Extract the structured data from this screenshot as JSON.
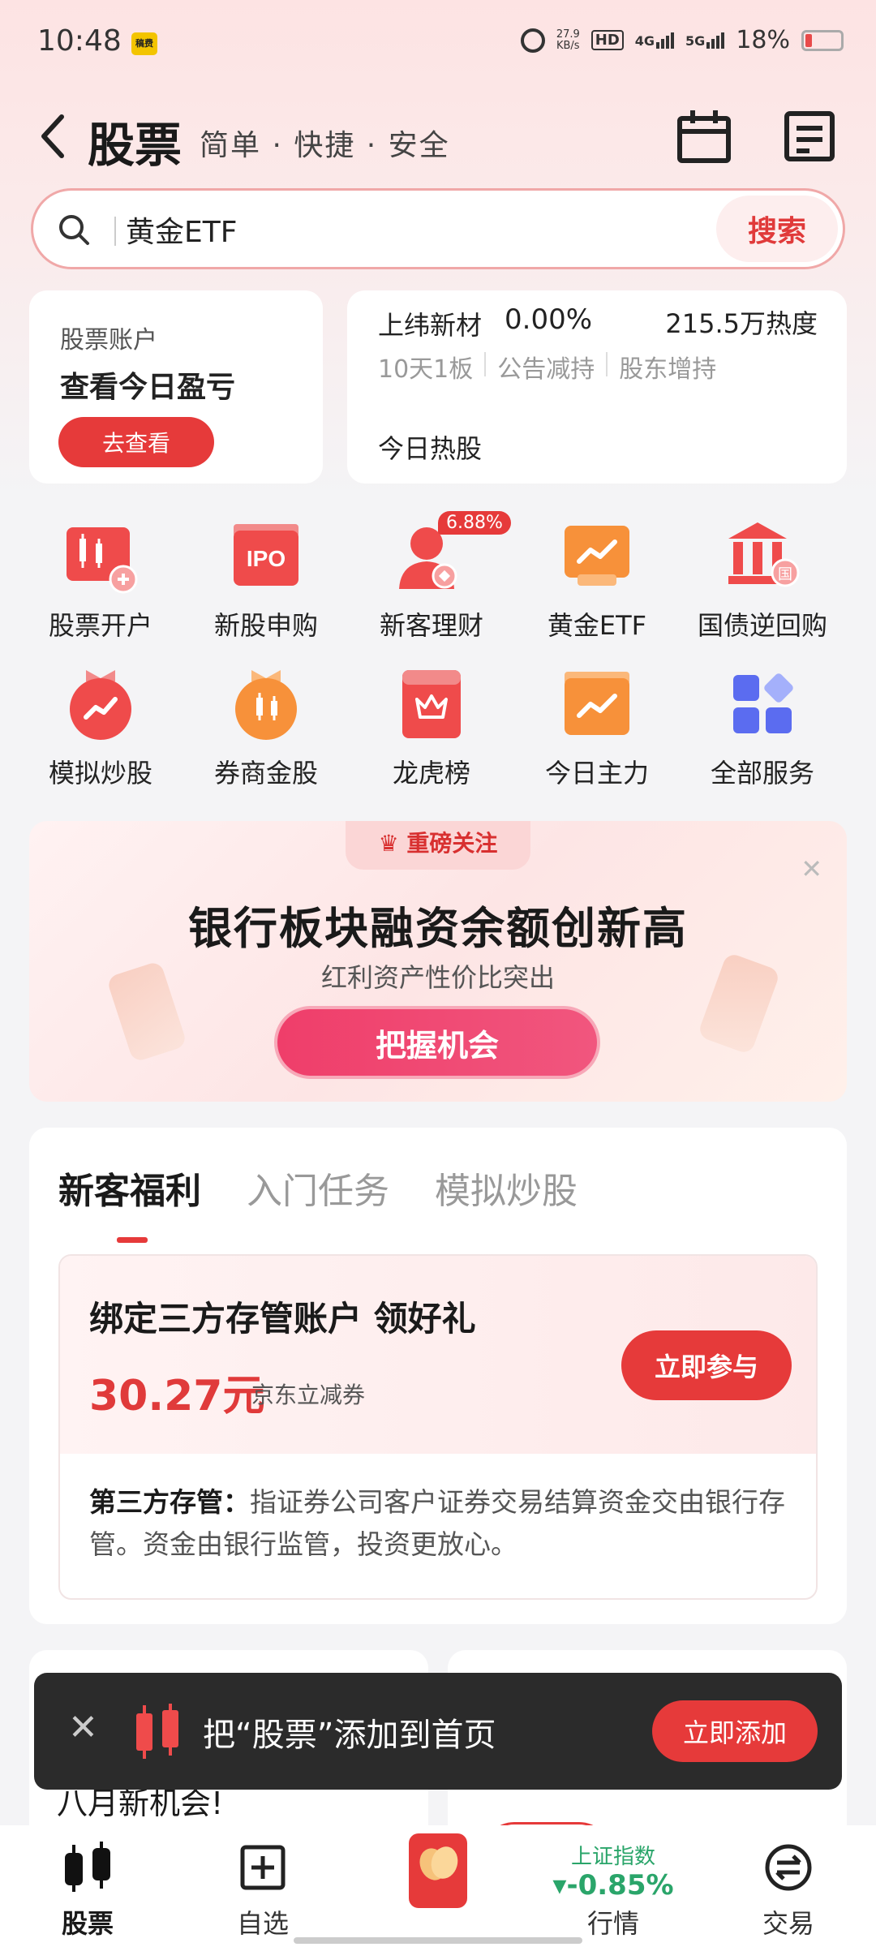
{
  "status_bar": {
    "time": "10:48",
    "notif_label": "稿费",
    "net_speed_value": "27.9",
    "net_speed_unit": "KB/s",
    "hd_label": "HD",
    "net1": "4G",
    "net2": "5G",
    "battery": "18%"
  },
  "header": {
    "title": "股票",
    "subtitle": "简单 · 快捷 · 安全"
  },
  "search": {
    "value": "黄金ETF",
    "button": "搜索"
  },
  "account_card": {
    "label": "股票账户",
    "headline": "查看今日盈亏",
    "button": "去查看"
  },
  "hot_card": {
    "stock_name": "上纬新材",
    "change": "0.00%",
    "heat": "215.5万热度",
    "tags": [
      "10天1板",
      "公告减持",
      "股东增持"
    ],
    "footer": "今日热股"
  },
  "services": [
    {
      "label": "股票开户",
      "icon": "account-open-icon"
    },
    {
      "label": "新股申购",
      "icon": "ipo-icon",
      "icon_text": "IPO"
    },
    {
      "label": "新客理财",
      "icon": "wealth-icon",
      "badge": "6.88%"
    },
    {
      "label": "黄金ETF",
      "icon": "gold-etf-icon"
    },
    {
      "label": "国债逆回购",
      "icon": "bond-repo-icon",
      "icon_text": "国"
    },
    {
      "label": "模拟炒股",
      "icon": "simulated-trading-icon"
    },
    {
      "label": "券商金股",
      "icon": "broker-stock-icon"
    },
    {
      "label": "龙虎榜",
      "icon": "dragon-tiger-icon"
    },
    {
      "label": "今日主力",
      "icon": "main-force-icon"
    },
    {
      "label": "全部服务",
      "icon": "all-services-icon"
    }
  ],
  "banner": {
    "tag": "重磅关注",
    "title": "银行板块融资余额创新高",
    "subtitle": "红利资产性价比突出",
    "button": "把握机会"
  },
  "welfare": {
    "tabs": [
      "新客福利",
      "入门任务",
      "模拟炒股"
    ],
    "card_title": "绑定三方存管账户  领好礼",
    "amount": "30.27元",
    "coupon": "京东立减券",
    "join_button": "立即参与",
    "desc_term": "第三方存管：",
    "desc_body": "指证券公司客户证券交易结算资金交由银行存管。资金由银行监管，投资更放心。"
  },
  "lower_card": {
    "peek_text": "八月新机会!"
  },
  "toast": {
    "text": "把“股票”添加到首页",
    "button": "立即添加"
  },
  "bottom_nav": {
    "items": [
      "股票",
      "自选",
      "",
      "行情",
      "交易"
    ],
    "index_name": "上证指数",
    "index_change": "-0.85%"
  },
  "colors": {
    "accent": "#e63a3a",
    "down": "#2aa56a"
  }
}
